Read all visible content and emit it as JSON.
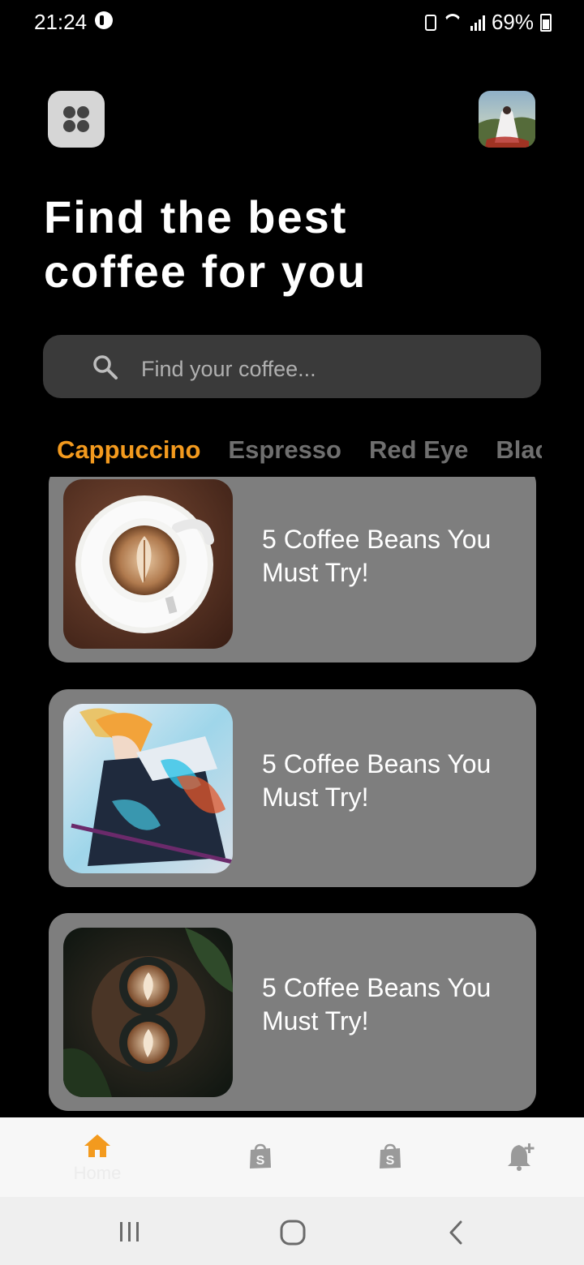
{
  "status_bar": {
    "time": "21:24",
    "battery": "69%"
  },
  "header": {
    "menu_icon": "grid-menu-icon",
    "avatar": "profile-avatar"
  },
  "headline": {
    "line1": "Find the best",
    "line2": "coffee for you"
  },
  "search": {
    "placeholder": "Find your coffee...",
    "icon": "search-icon"
  },
  "tabs": [
    {
      "label": "Cappuccino",
      "active": true
    },
    {
      "label": "Espresso",
      "active": false
    },
    {
      "label": "Red Eye",
      "active": false
    },
    {
      "label": "Black Coffee",
      "active": false
    }
  ],
  "cards": [
    {
      "title": "5 Coffee Beans You Must Try!",
      "image": "latte-art-cup-photo"
    },
    {
      "title": "5 Coffee Beans You Must Try!",
      "image": "anime-character-artwork"
    },
    {
      "title": "5 Coffee Beans You Must Try!",
      "image": "two-latte-cups-photo"
    }
  ],
  "bottom_nav": {
    "items": [
      {
        "label": "Home",
        "icon": "home-icon",
        "active": true
      },
      {
        "label": "",
        "icon": "shopping-bag-icon",
        "active": false
      },
      {
        "label": "",
        "icon": "shopping-bag-icon",
        "active": false
      },
      {
        "label": "",
        "icon": "notification-add-icon",
        "active": false
      }
    ]
  },
  "colors": {
    "background": "#000000",
    "accent": "#f39a1e",
    "card": "#7e7e7e",
    "search_bg": "#3a3a3a",
    "inactive_tab": "#6f6f6f"
  }
}
